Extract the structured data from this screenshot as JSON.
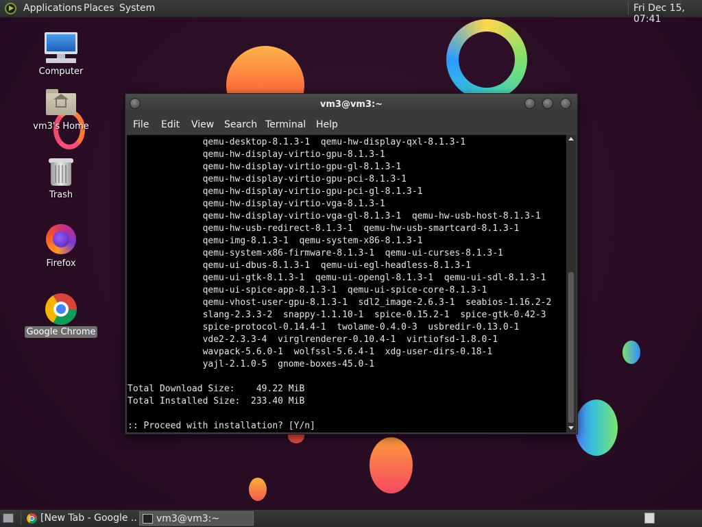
{
  "top_panel": {
    "menus": [
      "Applications",
      "Places",
      "System"
    ],
    "clock": "Fri Dec 15, 07:41"
  },
  "desktop_icons": [
    {
      "label": "Computer",
      "icon": "computer-icon"
    },
    {
      "label": "vm3's Home",
      "icon": "home-folder-icon"
    },
    {
      "label": "Trash",
      "icon": "trash-icon"
    },
    {
      "label": "Firefox",
      "icon": "firefox-icon"
    },
    {
      "label": "Google Chrome",
      "icon": "chrome-icon",
      "selected": true
    }
  ],
  "terminal": {
    "title": "vm3@vm3:~",
    "menu": [
      "File",
      "Edit",
      "View",
      "Search",
      "Terminal",
      "Help"
    ],
    "lines": [
      "              qemu-desktop-8.1.3-1  qemu-hw-display-qxl-8.1.3-1",
      "              qemu-hw-display-virtio-gpu-8.1.3-1",
      "              qemu-hw-display-virtio-gpu-gl-8.1.3-1",
      "              qemu-hw-display-virtio-gpu-pci-8.1.3-1",
      "              qemu-hw-display-virtio-gpu-pci-gl-8.1.3-1",
      "              qemu-hw-display-virtio-vga-8.1.3-1",
      "              qemu-hw-display-virtio-vga-gl-8.1.3-1  qemu-hw-usb-host-8.1.3-1",
      "              qemu-hw-usb-redirect-8.1.3-1  qemu-hw-usb-smartcard-8.1.3-1",
      "              qemu-img-8.1.3-1  qemu-system-x86-8.1.3-1",
      "              qemu-system-x86-firmware-8.1.3-1  qemu-ui-curses-8.1.3-1",
      "              qemu-ui-dbus-8.1.3-1  qemu-ui-egl-headless-8.1.3-1",
      "              qemu-ui-gtk-8.1.3-1  qemu-ui-opengl-8.1.3-1  qemu-ui-sdl-8.1.3-1",
      "              qemu-ui-spice-app-8.1.3-1  qemu-ui-spice-core-8.1.3-1",
      "              qemu-vhost-user-gpu-8.1.3-1  sdl2_image-2.6.3-1  seabios-1.16.2-2",
      "              slang-2.3.3-2  snappy-1.1.10-1  spice-0.15.2-1  spice-gtk-0.42-3",
      "              spice-protocol-0.14.4-1  twolame-0.4.0-3  usbredir-0.13.0-1",
      "              vde2-2.3.3-4  virglrenderer-0.10.4-1  virtiofsd-1.8.0-1",
      "              wavpack-5.6.0-1  wolfssl-5.6.4-1  xdg-user-dirs-0.18-1",
      "              yajl-2.1.0-5  gnome-boxes-45.0-1",
      "",
      "Total Download Size:    49.22 MiB",
      "Total Installed Size:  233.40 MiB",
      "",
      ":: Proceed with installation? [Y/n]"
    ]
  },
  "taskbar": {
    "tasks": [
      {
        "label": "[New Tab - Google ...",
        "icon": "chrome-icon",
        "active": false
      },
      {
        "label": "vm3@vm3:~",
        "icon": "terminal-icon",
        "active": true
      }
    ]
  }
}
